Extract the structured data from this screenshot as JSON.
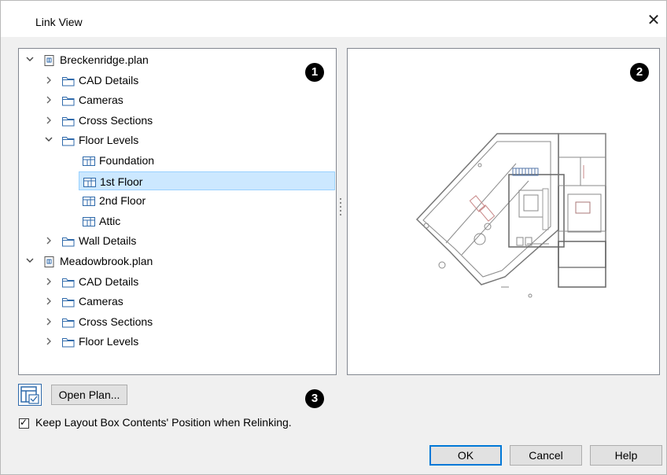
{
  "window": {
    "title": "Link View",
    "close_glyph": "✕"
  },
  "tree": [
    {
      "label": "Breckenridge.plan",
      "kind": "plan",
      "arrow": "expanded",
      "level": 0
    },
    {
      "label": "CAD Details",
      "kind": "folder",
      "arrow": "collapsed",
      "level": 1
    },
    {
      "label": "Cameras",
      "kind": "folder",
      "arrow": "collapsed",
      "level": 1
    },
    {
      "label": "Cross Sections",
      "kind": "folder",
      "arrow": "collapsed",
      "level": 1
    },
    {
      "label": "Floor Levels",
      "kind": "folder",
      "arrow": "expanded",
      "level": 1
    },
    {
      "label": "Foundation",
      "kind": "level",
      "arrow": "none",
      "level": 2
    },
    {
      "label": "1st Floor",
      "kind": "level",
      "arrow": "none",
      "level": 2,
      "selected": true
    },
    {
      "label": "2nd Floor",
      "kind": "level",
      "arrow": "none",
      "level": 2
    },
    {
      "label": "Attic",
      "kind": "level",
      "arrow": "none",
      "level": 2
    },
    {
      "label": "Wall Details",
      "kind": "folder",
      "arrow": "collapsed",
      "level": 1
    },
    {
      "label": "Meadowbrook.plan",
      "kind": "plan",
      "arrow": "expanded",
      "level": 0
    },
    {
      "label": "CAD Details",
      "kind": "folder",
      "arrow": "collapsed",
      "level": 1
    },
    {
      "label": "Cameras",
      "kind": "folder",
      "arrow": "collapsed",
      "level": 1
    },
    {
      "label": "Cross Sections",
      "kind": "folder",
      "arrow": "collapsed",
      "level": 1
    },
    {
      "label": "Floor Levels",
      "kind": "folder",
      "arrow": "collapsed",
      "level": 1
    }
  ],
  "callouts": {
    "one": "1",
    "two": "2",
    "three": "3"
  },
  "toolbar": {
    "view_toggle_icon": "layout-view-icon",
    "open_plan_label": "Open Plan..."
  },
  "options": {
    "keep_position_label": "Keep Layout Box Contents' Position when Relinking.",
    "keep_position_checked": true,
    "check_glyph": "✓"
  },
  "buttons": {
    "ok": "OK",
    "cancel": "Cancel",
    "help": "Help"
  },
  "colors": {
    "selection_bg": "#cce8ff",
    "selection_border": "#99d1ff",
    "accent": "#0078d7",
    "icon_blue": "#2f6aab"
  }
}
